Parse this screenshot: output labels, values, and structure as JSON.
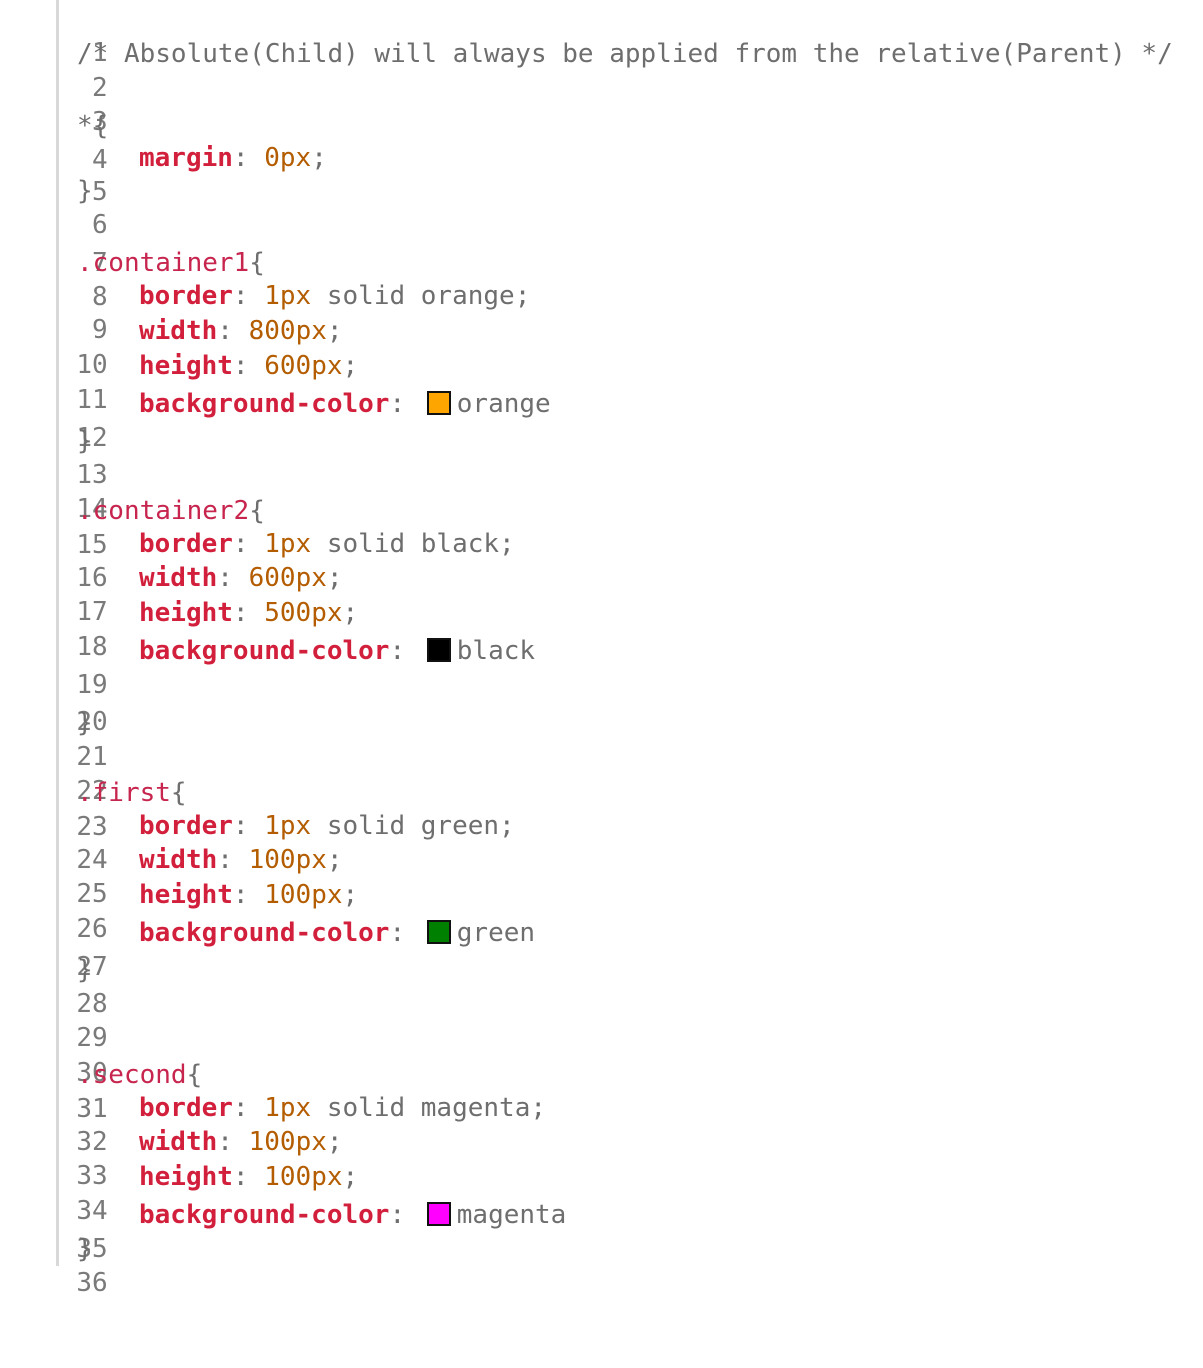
{
  "lines": [
    {
      "n": "1"
    },
    {
      "n": "2",
      "comment": "/* Absolute(Child) will always be applied from the relative(Parent) */"
    },
    {
      "n": "3"
    },
    {
      "n": "4",
      "sel": "*{"
    },
    {
      "n": "5",
      "prop": "margin",
      "num": "0",
      "unit": "px",
      "end": ";"
    },
    {
      "n": "6",
      "close": "}"
    },
    {
      "n": "7"
    },
    {
      "n": "8",
      "sel": ".container1",
      "brace": "{"
    },
    {
      "n": "9",
      "prop": "border",
      "num": "1",
      "unit": "px",
      "rest": " solid orange;"
    },
    {
      "n": "10",
      "prop": "width",
      "num": "800",
      "unit": "px",
      "end": ";"
    },
    {
      "n": "11",
      "prop": "height",
      "num": "600",
      "unit": "px",
      "end": ";"
    },
    {
      "n": "12",
      "prop": "background-color",
      "color": "orange",
      "hex": "#FFA500"
    },
    {
      "n": "13",
      "close": "}"
    },
    {
      "n": "14"
    },
    {
      "n": "15",
      "sel": ".container2",
      "brace": "{"
    },
    {
      "n": "16",
      "prop": "border",
      "num": "1",
      "unit": "px",
      "rest": " solid black;"
    },
    {
      "n": "17",
      "prop": "width",
      "num": "600",
      "unit": "px",
      "end": ";"
    },
    {
      "n": "18",
      "prop": "height",
      "num": "500",
      "unit": "px",
      "end": ";"
    },
    {
      "n": "19",
      "prop": "background-color",
      "color": "black",
      "hex": "#000000"
    },
    {
      "n": "20"
    },
    {
      "n": "21",
      "close": "}"
    },
    {
      "n": "22"
    },
    {
      "n": "23",
      "sel": ".first",
      "brace": "{"
    },
    {
      "n": "24",
      "prop": "border",
      "num": "1",
      "unit": "px",
      "rest": " solid green;"
    },
    {
      "n": "25",
      "prop": "width",
      "num": "100",
      "unit": "px",
      "end": ";"
    },
    {
      "n": "26",
      "prop": "height",
      "num": "100",
      "unit": "px",
      "end": ";"
    },
    {
      "n": "27",
      "prop": "background-color",
      "color": "green",
      "hex": "#008000"
    },
    {
      "n": "28",
      "close": "}"
    },
    {
      "n": "29"
    },
    {
      "n": "30"
    },
    {
      "n": "31",
      "sel": ".second",
      "brace": "{"
    },
    {
      "n": "32",
      "prop": "border",
      "num": "1",
      "unit": "px",
      "rest": " solid magenta;"
    },
    {
      "n": "33",
      "prop": "width",
      "num": "100",
      "unit": "px",
      "end": ";"
    },
    {
      "n": "34",
      "prop": "height",
      "num": "100",
      "unit": "px",
      "end": ";"
    },
    {
      "n": "35",
      "prop": "background-color",
      "color": "magenta",
      "hex": "#FF00FF"
    },
    {
      "n": "36",
      "close": "}"
    }
  ]
}
